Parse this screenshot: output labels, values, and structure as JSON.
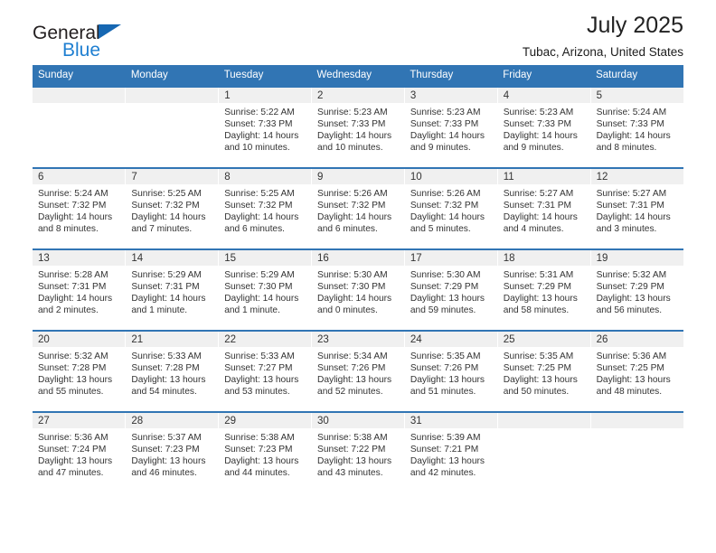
{
  "brand": {
    "name_top": "General",
    "name_bottom": "Blue",
    "accent_color": "#1f7fd1",
    "triangle_color": "#1667b2",
    "triangle_icon": "triangle-icon"
  },
  "header": {
    "title": "July 2025",
    "subtitle": "Tubac, Arizona, United States"
  },
  "calendar": {
    "header_bg": "#3175b4",
    "daynum_band_bg": "#f0f0f0",
    "weekday_labels": [
      "Sunday",
      "Monday",
      "Tuesday",
      "Wednesday",
      "Thursday",
      "Friday",
      "Saturday"
    ],
    "labels": {
      "sunrise": "Sunrise:",
      "sunset": "Sunset:",
      "daylight": "Daylight:"
    },
    "weeks": [
      [
        {
          "day": "",
          "empty": true
        },
        {
          "day": "",
          "empty": true
        },
        {
          "day": "1",
          "sunrise": "Sunrise: 5:22 AM",
          "sunset": "Sunset: 7:33 PM",
          "daylight_l1": "Daylight: 14 hours",
          "daylight_l2": "and 10 minutes."
        },
        {
          "day": "2",
          "sunrise": "Sunrise: 5:23 AM",
          "sunset": "Sunset: 7:33 PM",
          "daylight_l1": "Daylight: 14 hours",
          "daylight_l2": "and 10 minutes."
        },
        {
          "day": "3",
          "sunrise": "Sunrise: 5:23 AM",
          "sunset": "Sunset: 7:33 PM",
          "daylight_l1": "Daylight: 14 hours",
          "daylight_l2": "and 9 minutes."
        },
        {
          "day": "4",
          "sunrise": "Sunrise: 5:23 AM",
          "sunset": "Sunset: 7:33 PM",
          "daylight_l1": "Daylight: 14 hours",
          "daylight_l2": "and 9 minutes."
        },
        {
          "day": "5",
          "sunrise": "Sunrise: 5:24 AM",
          "sunset": "Sunset: 7:33 PM",
          "daylight_l1": "Daylight: 14 hours",
          "daylight_l2": "and 8 minutes."
        }
      ],
      [
        {
          "day": "6",
          "sunrise": "Sunrise: 5:24 AM",
          "sunset": "Sunset: 7:32 PM",
          "daylight_l1": "Daylight: 14 hours",
          "daylight_l2": "and 8 minutes."
        },
        {
          "day": "7",
          "sunrise": "Sunrise: 5:25 AM",
          "sunset": "Sunset: 7:32 PM",
          "daylight_l1": "Daylight: 14 hours",
          "daylight_l2": "and 7 minutes."
        },
        {
          "day": "8",
          "sunrise": "Sunrise: 5:25 AM",
          "sunset": "Sunset: 7:32 PM",
          "daylight_l1": "Daylight: 14 hours",
          "daylight_l2": "and 6 minutes."
        },
        {
          "day": "9",
          "sunrise": "Sunrise: 5:26 AM",
          "sunset": "Sunset: 7:32 PM",
          "daylight_l1": "Daylight: 14 hours",
          "daylight_l2": "and 6 minutes."
        },
        {
          "day": "10",
          "sunrise": "Sunrise: 5:26 AM",
          "sunset": "Sunset: 7:32 PM",
          "daylight_l1": "Daylight: 14 hours",
          "daylight_l2": "and 5 minutes."
        },
        {
          "day": "11",
          "sunrise": "Sunrise: 5:27 AM",
          "sunset": "Sunset: 7:31 PM",
          "daylight_l1": "Daylight: 14 hours",
          "daylight_l2": "and 4 minutes."
        },
        {
          "day": "12",
          "sunrise": "Sunrise: 5:27 AM",
          "sunset": "Sunset: 7:31 PM",
          "daylight_l1": "Daylight: 14 hours",
          "daylight_l2": "and 3 minutes."
        }
      ],
      [
        {
          "day": "13",
          "sunrise": "Sunrise: 5:28 AM",
          "sunset": "Sunset: 7:31 PM",
          "daylight_l1": "Daylight: 14 hours",
          "daylight_l2": "and 2 minutes."
        },
        {
          "day": "14",
          "sunrise": "Sunrise: 5:29 AM",
          "sunset": "Sunset: 7:31 PM",
          "daylight_l1": "Daylight: 14 hours",
          "daylight_l2": "and 1 minute."
        },
        {
          "day": "15",
          "sunrise": "Sunrise: 5:29 AM",
          "sunset": "Sunset: 7:30 PM",
          "daylight_l1": "Daylight: 14 hours",
          "daylight_l2": "and 1 minute."
        },
        {
          "day": "16",
          "sunrise": "Sunrise: 5:30 AM",
          "sunset": "Sunset: 7:30 PM",
          "daylight_l1": "Daylight: 14 hours",
          "daylight_l2": "and 0 minutes."
        },
        {
          "day": "17",
          "sunrise": "Sunrise: 5:30 AM",
          "sunset": "Sunset: 7:29 PM",
          "daylight_l1": "Daylight: 13 hours",
          "daylight_l2": "and 59 minutes."
        },
        {
          "day": "18",
          "sunrise": "Sunrise: 5:31 AM",
          "sunset": "Sunset: 7:29 PM",
          "daylight_l1": "Daylight: 13 hours",
          "daylight_l2": "and 58 minutes."
        },
        {
          "day": "19",
          "sunrise": "Sunrise: 5:32 AM",
          "sunset": "Sunset: 7:29 PM",
          "daylight_l1": "Daylight: 13 hours",
          "daylight_l2": "and 56 minutes."
        }
      ],
      [
        {
          "day": "20",
          "sunrise": "Sunrise: 5:32 AM",
          "sunset": "Sunset: 7:28 PM",
          "daylight_l1": "Daylight: 13 hours",
          "daylight_l2": "and 55 minutes."
        },
        {
          "day": "21",
          "sunrise": "Sunrise: 5:33 AM",
          "sunset": "Sunset: 7:28 PM",
          "daylight_l1": "Daylight: 13 hours",
          "daylight_l2": "and 54 minutes."
        },
        {
          "day": "22",
          "sunrise": "Sunrise: 5:33 AM",
          "sunset": "Sunset: 7:27 PM",
          "daylight_l1": "Daylight: 13 hours",
          "daylight_l2": "and 53 minutes."
        },
        {
          "day": "23",
          "sunrise": "Sunrise: 5:34 AM",
          "sunset": "Sunset: 7:26 PM",
          "daylight_l1": "Daylight: 13 hours",
          "daylight_l2": "and 52 minutes."
        },
        {
          "day": "24",
          "sunrise": "Sunrise: 5:35 AM",
          "sunset": "Sunset: 7:26 PM",
          "daylight_l1": "Daylight: 13 hours",
          "daylight_l2": "and 51 minutes."
        },
        {
          "day": "25",
          "sunrise": "Sunrise: 5:35 AM",
          "sunset": "Sunset: 7:25 PM",
          "daylight_l1": "Daylight: 13 hours",
          "daylight_l2": "and 50 minutes."
        },
        {
          "day": "26",
          "sunrise": "Sunrise: 5:36 AM",
          "sunset": "Sunset: 7:25 PM",
          "daylight_l1": "Daylight: 13 hours",
          "daylight_l2": "and 48 minutes."
        }
      ],
      [
        {
          "day": "27",
          "sunrise": "Sunrise: 5:36 AM",
          "sunset": "Sunset: 7:24 PM",
          "daylight_l1": "Daylight: 13 hours",
          "daylight_l2": "and 47 minutes."
        },
        {
          "day": "28",
          "sunrise": "Sunrise: 5:37 AM",
          "sunset": "Sunset: 7:23 PM",
          "daylight_l1": "Daylight: 13 hours",
          "daylight_l2": "and 46 minutes."
        },
        {
          "day": "29",
          "sunrise": "Sunrise: 5:38 AM",
          "sunset": "Sunset: 7:23 PM",
          "daylight_l1": "Daylight: 13 hours",
          "daylight_l2": "and 44 minutes."
        },
        {
          "day": "30",
          "sunrise": "Sunrise: 5:38 AM",
          "sunset": "Sunset: 7:22 PM",
          "daylight_l1": "Daylight: 13 hours",
          "daylight_l2": "and 43 minutes."
        },
        {
          "day": "31",
          "sunrise": "Sunrise: 5:39 AM",
          "sunset": "Sunset: 7:21 PM",
          "daylight_l1": "Daylight: 13 hours",
          "daylight_l2": "and 42 minutes."
        },
        {
          "day": "",
          "empty": true
        },
        {
          "day": "",
          "empty": true
        }
      ]
    ]
  }
}
